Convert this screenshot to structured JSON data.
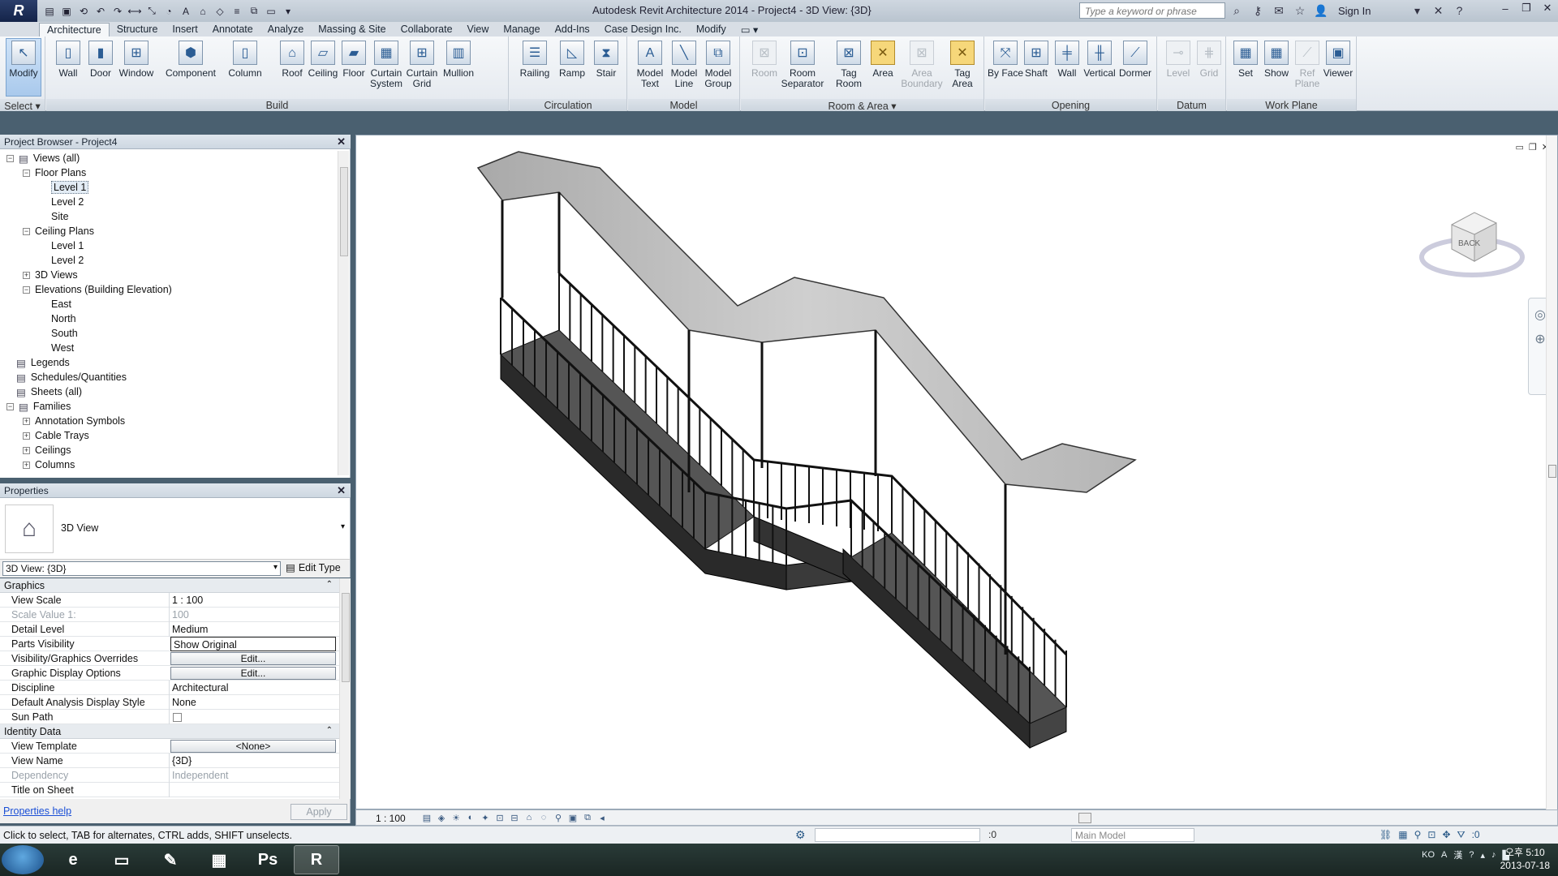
{
  "window": {
    "title": "Autodesk Revit Architecture 2014 -     Project4 - 3D View: {3D}",
    "search_placeholder": "Type a keyword or phrase",
    "sign_in": "Sign In",
    "logo": "R"
  },
  "ribbon": {
    "tabs": [
      "Architecture",
      "Structure",
      "Insert",
      "Annotate",
      "Analyze",
      "Massing & Site",
      "Collaborate",
      "View",
      "Manage",
      "Add-Ins",
      "Case Design Inc.",
      "Modify"
    ],
    "active_tab": "Architecture",
    "select_label": "Select ▾",
    "groups": {
      "build": "Build",
      "circulation": "Circulation",
      "model": "Model",
      "room_area": "Room & Area ▾",
      "opening": "Opening",
      "datum": "Datum",
      "work_plane": "Work Plane"
    },
    "buttons": {
      "modify": "Modify",
      "wall": "Wall",
      "door": "Door",
      "window": "Window",
      "component": "Component",
      "column": "Column",
      "roof": "Roof",
      "ceiling": "Ceiling",
      "floor": "Floor",
      "curtain_system": "Curtain System",
      "curtain_grid": "Curtain Grid",
      "mullion": "Mullion",
      "railing": "Railing",
      "ramp": "Ramp",
      "stair": "Stair",
      "model_text": "Model Text",
      "model_line": "Model Line",
      "model_group": "Model Group",
      "room": "Room",
      "room_separator": "Room Separator",
      "tag_room": "Tag Room",
      "area": "Area",
      "area_boundary": "Area Boundary",
      "tag_area": "Tag Area",
      "by_face": "By Face",
      "shaft": "Shaft",
      "wall_opening": "Wall",
      "vertical": "Vertical",
      "dormer": "Dormer",
      "level": "Level",
      "grid": "Grid",
      "set": "Set",
      "show": "Show",
      "ref_plane": "Ref Plane",
      "viewer": "Viewer"
    }
  },
  "project_browser": {
    "title": "Project Browser - Project4",
    "items": [
      {
        "label": "Views (all)",
        "expander": "−"
      },
      {
        "label": "Floor Plans",
        "expander": "−"
      },
      {
        "label": "Level 1",
        "expander": ""
      },
      {
        "label": "Level 2",
        "expander": ""
      },
      {
        "label": "Site",
        "expander": ""
      },
      {
        "label": "Ceiling Plans",
        "expander": "−"
      },
      {
        "label": "Level 1",
        "expander": ""
      },
      {
        "label": "Level 2",
        "expander": ""
      },
      {
        "label": "3D Views",
        "expander": "+"
      },
      {
        "label": "Elevations (Building Elevation)",
        "expander": "−"
      },
      {
        "label": "East",
        "expander": ""
      },
      {
        "label": "North",
        "expander": ""
      },
      {
        "label": "South",
        "expander": ""
      },
      {
        "label": "West",
        "expander": ""
      },
      {
        "label": "Legends",
        "expander": ""
      },
      {
        "label": "Schedules/Quantities",
        "expander": ""
      },
      {
        "label": "Sheets (all)",
        "expander": ""
      },
      {
        "label": "Families",
        "expander": "−"
      },
      {
        "label": "Annotation Symbols",
        "expander": "+"
      },
      {
        "label": "Cable Trays",
        "expander": "+"
      },
      {
        "label": "Ceilings",
        "expander": "+"
      },
      {
        "label": "Columns",
        "expander": "+"
      }
    ]
  },
  "properties": {
    "title": "Properties",
    "type_name": "3D View",
    "view_selector": "3D View: {3D}",
    "edit_type": "Edit Type",
    "groups": {
      "graphics": "Graphics",
      "identity": "Identity Data"
    },
    "rows": {
      "view_scale": {
        "k": "View Scale",
        "v": "1 : 100"
      },
      "scale_value": {
        "k": "Scale Value    1:",
        "v": "100"
      },
      "detail_level": {
        "k": "Detail Level",
        "v": "Medium"
      },
      "parts_visibility": {
        "k": "Parts Visibility",
        "v": "Show Original"
      },
      "vg_overrides": {
        "k": "Visibility/Graphics Overrides",
        "v": "Edit..."
      },
      "graphic_display": {
        "k": "Graphic Display Options",
        "v": "Edit..."
      },
      "discipline": {
        "k": "Discipline",
        "v": "Architectural"
      },
      "analysis_style": {
        "k": "Default Analysis Display Style",
        "v": "None"
      },
      "sun_path": {
        "k": "Sun Path",
        "v": ""
      },
      "view_template": {
        "k": "View Template",
        "v": "<None>"
      },
      "view_name": {
        "k": "View Name",
        "v": "{3D}"
      },
      "dependency": {
        "k": "Dependency",
        "v": "Independent"
      },
      "title_on_sheet": {
        "k": "Title on Sheet",
        "v": ""
      }
    },
    "help_link": "Properties help",
    "apply": "Apply"
  },
  "view_bar": {
    "scale": "1 : 100"
  },
  "status_bar": {
    "message": "Click to select, TAB for alternates, CTRL adds, SHIFT unselects.",
    "press_drag": ":0",
    "model": "Main Model",
    "filter_count": ":0"
  },
  "taskbar": {
    "lang": "KO",
    "time": "오후 5:10",
    "date": "2013-07-18"
  },
  "viewcube": {
    "face": "BACK"
  }
}
